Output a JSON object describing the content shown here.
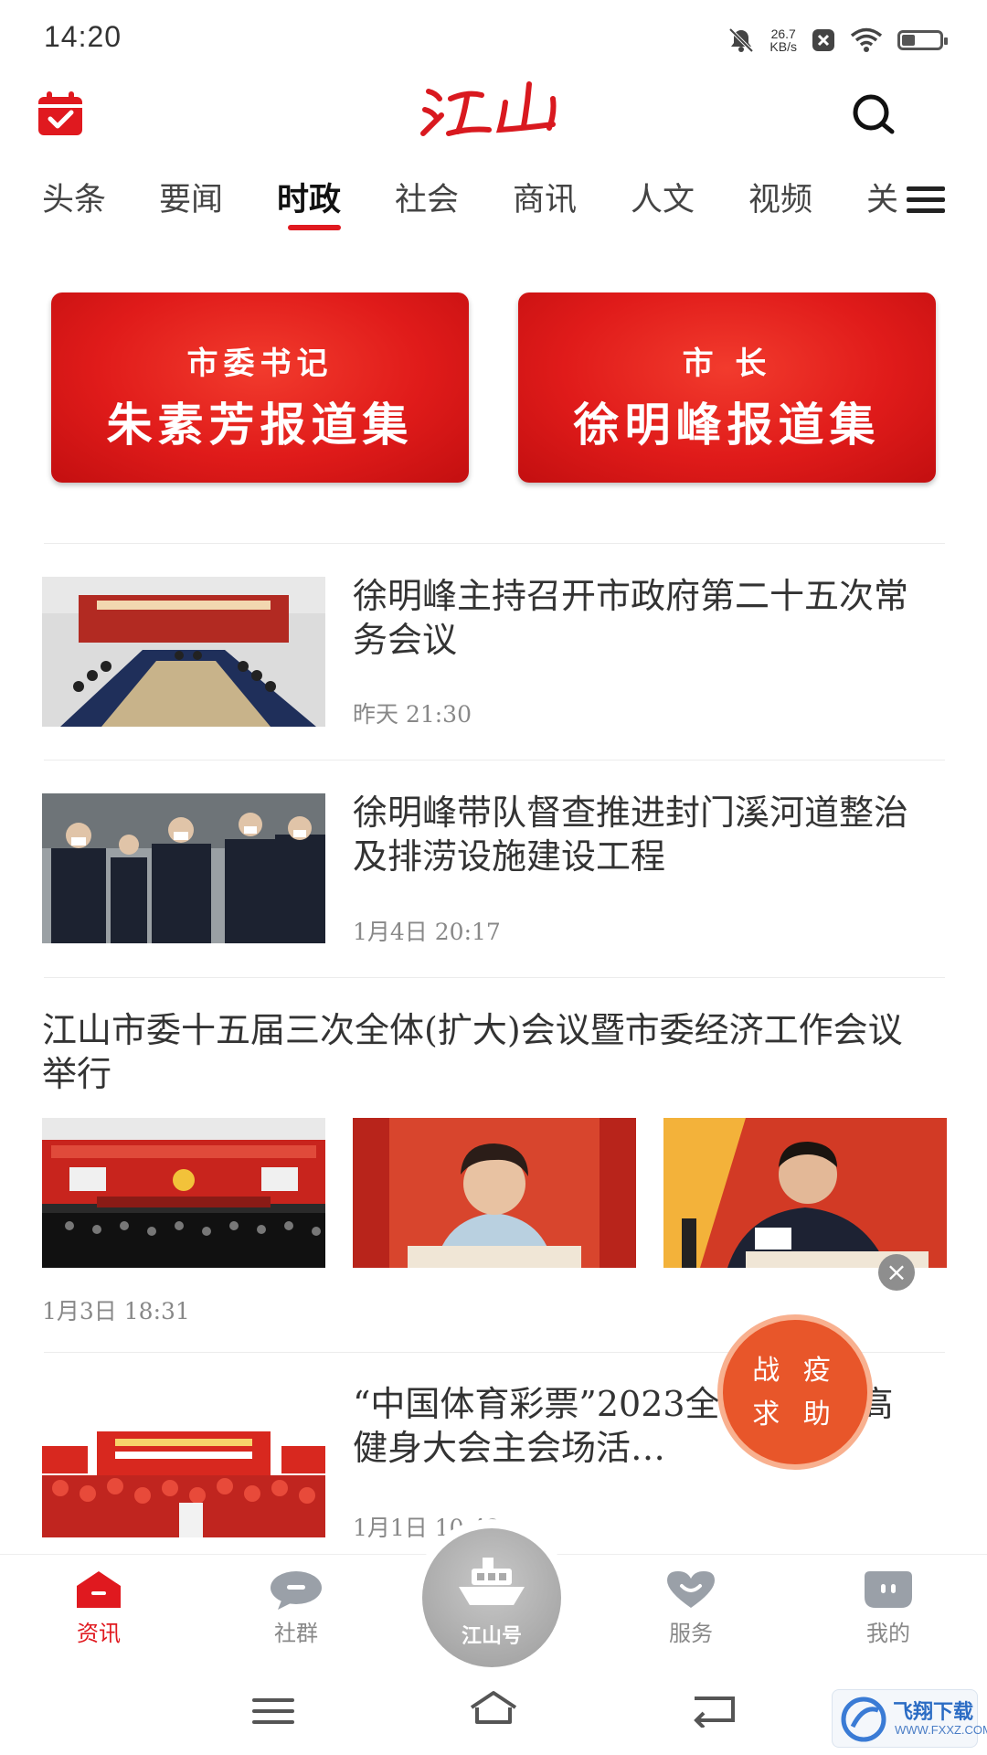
{
  "status_bar": {
    "time": "14:20",
    "net_speed_value": "26.7",
    "net_speed_unit": "KB/s",
    "battery_level": 0.35
  },
  "header": {
    "logo_text": "江山",
    "calendar_icon": "calendar-check-icon",
    "search_icon": "search-icon"
  },
  "tabs": {
    "items": [
      "头条",
      "要闻",
      "时政",
      "社会",
      "商讯",
      "人文",
      "视频",
      "关"
    ],
    "active": "时政",
    "menu_icon": "menu-icon"
  },
  "banners": [
    {
      "line1": "市委书记",
      "line2": "朱素芳报道集"
    },
    {
      "line1": "市 长",
      "line2": "徐明峰报道集"
    }
  ],
  "news": [
    {
      "title": "徐明峰主持召开市政府第二十五次常务会议",
      "time": "昨天 21:30"
    },
    {
      "title": "徐明峰带队督查推进封门溪河道整治及排涝设施建设工程",
      "time": "1月4日 20:17"
    },
    {
      "title": "江山市委十五届三次全体(扩大)会议暨市委经济工作会议举行",
      "time": "1月3日 18:31"
    },
    {
      "title": "“中国体育彩票”2023全国新年登高健身大会主会场活…",
      "time": "1月1日 10:42"
    }
  ],
  "float_button": {
    "line1": "战 疫",
    "line2": "求 助",
    "close": "×"
  },
  "bottom_tabs": {
    "items": [
      "资讯",
      "社群",
      "江山号",
      "服务",
      "我的"
    ],
    "active": "资讯"
  },
  "watermark": {
    "title": "飞翔下载",
    "url": "WWW.FXXZ.COM"
  },
  "colors": {
    "brand": "#e0191f",
    "tab_active": "#111111",
    "text": "#333333",
    "muted": "#888888",
    "fab": "#e8562a"
  }
}
